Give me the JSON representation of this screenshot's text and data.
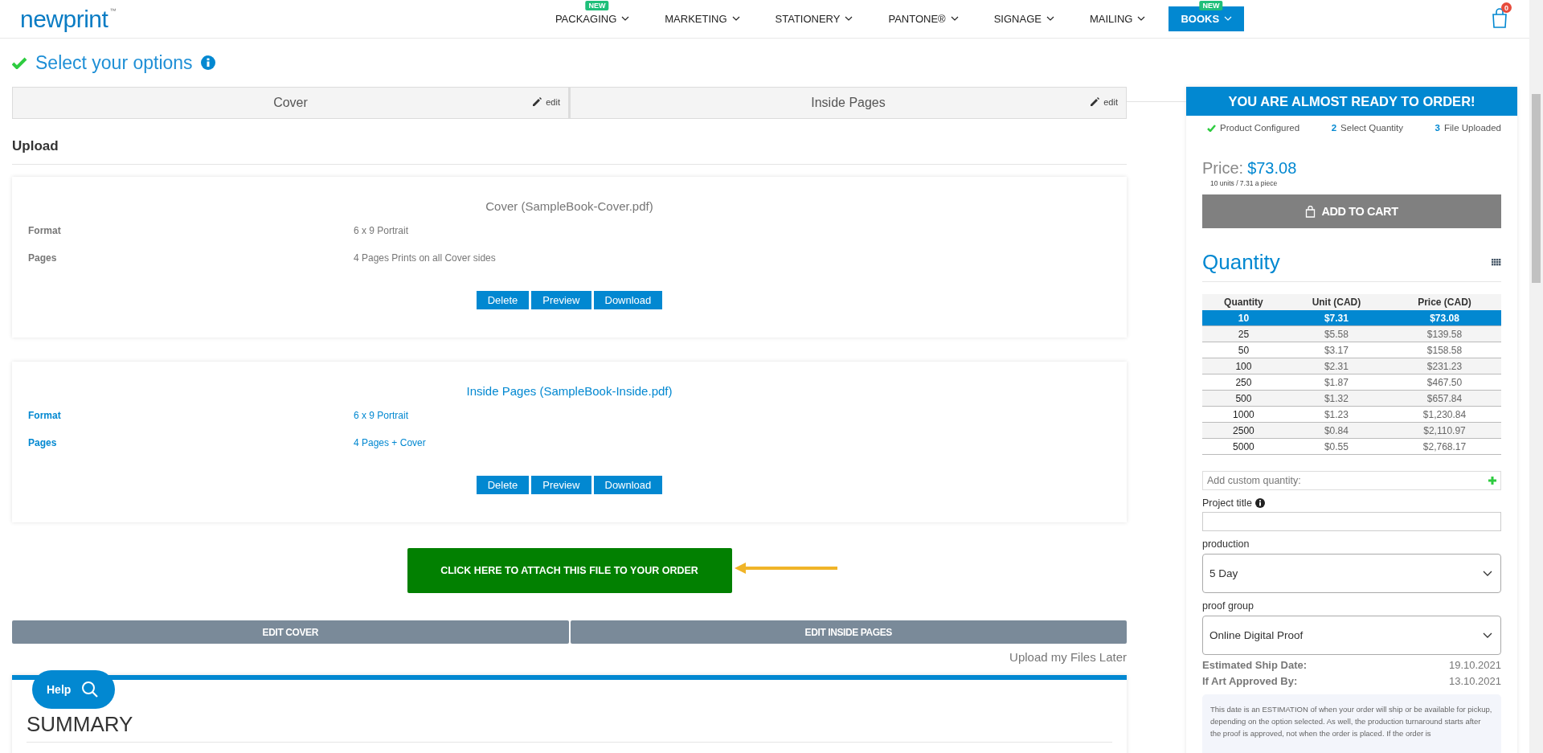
{
  "header": {
    "logo": "newprint",
    "logo_mark": "™",
    "nav": [
      {
        "label": "PACKAGING",
        "badge": "NEW",
        "selected": false
      },
      {
        "label": "MARKETING",
        "selected": false
      },
      {
        "label": "STATIONERY",
        "selected": false
      },
      {
        "label": "PANTONE®",
        "selected": false
      },
      {
        "label": "SIGNAGE",
        "selected": false
      },
      {
        "label": "MAILING",
        "selected": false
      },
      {
        "label": "BOOKS",
        "badge": "NEW",
        "selected": true
      }
    ],
    "cart_count": "0"
  },
  "options": {
    "title": "Select your options",
    "tabs": [
      {
        "label": "Cover",
        "edit": "edit"
      },
      {
        "label": "Inside Pages",
        "edit": "edit"
      }
    ]
  },
  "upload": {
    "title": "Upload",
    "files": [
      {
        "title": "Cover (SampleBook-Cover.pdf)",
        "selected": false,
        "fields": [
          {
            "label": "Format",
            "value": "6 x 9 Portrait"
          },
          {
            "label": "Pages",
            "value": "4 Pages Prints on all Cover sides"
          }
        ],
        "buttons": [
          "Delete",
          "Preview",
          "Download"
        ]
      },
      {
        "title": "Inside Pages (SampleBook-Inside.pdf)",
        "selected": true,
        "fields": [
          {
            "label": "Format",
            "value": "6 x 9 Portrait"
          },
          {
            "label": "Pages",
            "value": "4 Pages + Cover"
          }
        ],
        "buttons": [
          "Delete",
          "Preview",
          "Download"
        ]
      }
    ],
    "attach_button": "CLICK HERE TO ATTACH THIS FILE TO YOUR ORDER",
    "edit_buttons": [
      "EDIT COVER",
      "EDIT INSIDE PAGES"
    ],
    "later_link": "Upload my Files Later"
  },
  "summary": {
    "title": "SUMMARY"
  },
  "help": {
    "label": "Help"
  },
  "order": {
    "banner": "YOU ARE ALMOST READY TO ORDER!",
    "steps": [
      {
        "label": "Product Configured",
        "done": true
      },
      {
        "number": "2",
        "label": "Select Quantity",
        "done": false
      },
      {
        "number": "3",
        "label": "File Uploaded",
        "done": false
      }
    ],
    "price_label": "Price:",
    "price": "$73.08",
    "price_note": "10 units / 7.31 a piece",
    "add_to_cart": "ADD TO CART",
    "quantity_title": "Quantity",
    "table": {
      "columns": [
        "Quantity",
        "Unit (CAD)",
        "Price (CAD)"
      ],
      "rows": [
        {
          "cells": [
            "10",
            "$7.31",
            "$73.08"
          ],
          "selected": true
        },
        {
          "cells": [
            "25",
            "$5.58",
            "$139.58"
          ],
          "selected": false
        },
        {
          "cells": [
            "50",
            "$3.17",
            "$158.58"
          ],
          "selected": false
        },
        {
          "cells": [
            "100",
            "$2.31",
            "$231.23"
          ],
          "selected": false
        },
        {
          "cells": [
            "250",
            "$1.87",
            "$467.50"
          ],
          "selected": false
        },
        {
          "cells": [
            "500",
            "$1.32",
            "$657.84"
          ],
          "selected": false
        },
        {
          "cells": [
            "1000",
            "$1.23",
            "$1,230.84"
          ],
          "selected": false
        },
        {
          "cells": [
            "2500",
            "$0.84",
            "$2,110.97"
          ],
          "selected": false
        },
        {
          "cells": [
            "5000",
            "$0.55",
            "$2,768.17"
          ],
          "selected": false
        }
      ]
    },
    "custom_quantity": {
      "placeholder": "Add custom quantity:"
    },
    "project_title": {
      "label": "Project title"
    },
    "production": {
      "label": "production",
      "value": "5 Day"
    },
    "proof_group": {
      "label": "proof group",
      "value": "Online Digital Proof"
    },
    "dates": [
      {
        "label": "Estimated Ship Date:",
        "value": "19.10.2021"
      },
      {
        "label": "If Art Approved By:",
        "value": "13.10.2021"
      }
    ],
    "note": "This date is an ESTIMATION of when your order will ship or be available for pickup, depending on the option selected. As well, the production turnaround starts after the proof is approved, not when the order is placed. If the order is"
  }
}
